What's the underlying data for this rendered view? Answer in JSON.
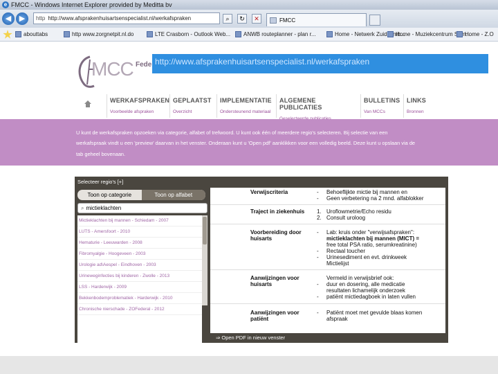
{
  "browser": {
    "title": "FMCC - Windows Internet Explorer provided by Meditta bv",
    "address": "http://www.afsprakenhuisartsenspecialist.nl/werkafspraken",
    "address_prefix": "http",
    "tab_label": "FMCC",
    "favorites": [
      "abouttabs",
      "http www.zorgnetpit.nl.do",
      "LTE Crasborn - Outlook Web...",
      "ANWB routeplanner - plan r...",
      "Home - Netwerk Zuid Limb...",
      "Home - Muziekcentrum Som...",
      "Home - Z.O"
    ]
  },
  "site": {
    "logo_text": "MCC",
    "federatie": "Feder",
    "url_tooltip": "http://www.afsprakenhuisartsenspecialist.nl/werkafspraken",
    "nav": [
      {
        "title": "WERKAFSPRAKEN",
        "sub": "Voorbeelde afspraken"
      },
      {
        "title": "GEPLAATST",
        "sub": "Overzicht"
      },
      {
        "title": "IMPLEMENTATIE",
        "sub": "Ondersteunend materiaal"
      },
      {
        "title": "ALGEMENE PUBLICATIES",
        "sub": "Geselecteerde publicaties"
      },
      {
        "title": "BULLETINS",
        "sub": "Van MCCs"
      },
      {
        "title": "LINKS",
        "sub": "Bronnen"
      }
    ],
    "intro": [
      "U kunt de werkafspraken opzoeken via categorie, alfabet of trefwoord. U kunt ook één of meerdere regio's selecteren. Bij selectie van een",
      "werkafspraak vindt u een 'preview' daarvan in het venster. Onderaan kunt u 'Open pdf' aanklikken voor een volledig beeld. Deze kunt u opslaan via de",
      "tab geheel bovenaan."
    ]
  },
  "app": {
    "select_regions": "Selecteer regio's [+]",
    "toggle": [
      "Toon op categorie",
      "Toon op alfabet"
    ],
    "search_value": "mictieklachten",
    "results": [
      "Mictieklachten bij mannen - Schiedam - 2007",
      "LUTS - Amersfoort - 2010",
      "Hematurie - Leeuwarden - 2008",
      "Fibromyalgie - Hoogeveen - 2003",
      "Urologie ad\\Aespel - Eindhoven - 2003",
      "Urineweginfecties bij kinderen - Zwolle - 2013",
      "LSS - Harderwijk - 2009",
      "Bekkenbodemproblematiek - Harderwijk - 2010",
      "Chronische nierschade - ZOFederal - 2012"
    ],
    "preview": [
      {
        "label": "Verwijscriteria",
        "lines": [
          [
            "-",
            "Behoeflijkte mictie bij mannen en"
          ],
          [
            "-",
            "Geen verbetering na 2 mnd. alfablokker"
          ]
        ]
      },
      {
        "label": "Traject in ziekenhuis",
        "lines": [
          [
            "1.",
            "Uroflowmetrie/Echo residu"
          ],
          [
            "2.",
            "Consult uroloog"
          ]
        ]
      },
      {
        "label": "Voorbereiding door huisarts",
        "lines": [
          [
            "-",
            "Lab: kruis onder \"verwijsafspraken\":"
          ],
          [
            "",
            "mictieklachten bij mannen (MICT) ="
          ],
          [
            "",
            "free total PSA ratio, serumkreatinine)"
          ],
          [
            "-",
            "Rectaal toucher"
          ],
          [
            "-",
            "Urinesediment en evt. drinkweek"
          ],
          [
            "",
            "Mictielijst"
          ]
        ]
      },
      {
        "label": "Aanwijzingen voor huisarts",
        "lines": [
          [
            "",
            "Vermeld in verwijsbrief ook:"
          ],
          [
            "-",
            "duur en dosering, alle medicatie"
          ],
          [
            "",
            "resultaten lichamelijk onderzoek"
          ],
          [
            "-",
            "patiënt mictiedagboek in laten vullen"
          ]
        ]
      },
      {
        "label": "Aanwijzingen voor patiënt",
        "lines": [
          [
            "-",
            "Patiënt moet met gevulde blaas komen"
          ],
          [
            "",
            "afspraak"
          ]
        ]
      }
    ],
    "open_pdf": "⇒ Open PDF in nieuw venster"
  }
}
